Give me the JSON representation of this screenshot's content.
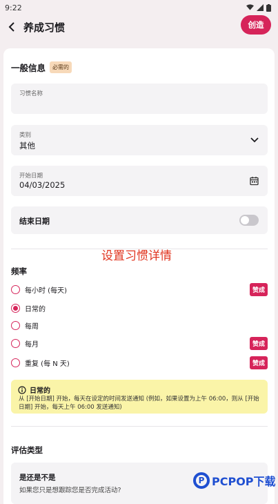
{
  "status": {
    "time": "9:22"
  },
  "appbar": {
    "title": "养成习惯",
    "create_label": "创造"
  },
  "general": {
    "heading": "一般信息",
    "required_badge": "必需的"
  },
  "fields": {
    "habit_name": {
      "label": "习惯名称",
      "value": ""
    },
    "category": {
      "label": "类别",
      "value": "其他"
    },
    "start_date": {
      "label": "开始日期",
      "value": "04/03/2025"
    },
    "end_date": {
      "label": "结束日期",
      "enabled": false
    }
  },
  "overlay_text": "设置习惯详情",
  "frequency": {
    "heading": "频率",
    "options": [
      {
        "label": "每小时 (每天)",
        "selected": false,
        "pro": "赞成"
      },
      {
        "label": "日常的",
        "selected": true,
        "pro": ""
      },
      {
        "label": "每周",
        "selected": false,
        "pro": ""
      },
      {
        "label": "每月",
        "selected": false,
        "pro": "赞成"
      },
      {
        "label": "重复 (每 N 天)",
        "selected": false,
        "pro": "赞成"
      }
    ]
  },
  "info": {
    "title": "日常的",
    "body": "从 [开始日期] 开始，每天在设定的时间发送通知 (例如，如果设置为上午 06:00，则从 [开始日期] 开始，每天上午 06:00 发送通知)"
  },
  "evaluation": {
    "heading": "评估类型",
    "option_title": "是还是不是",
    "option_subtitle": "如果您只是想跟踪您是否完成活动?"
  },
  "watermark": {
    "text": "PCPOP下载",
    "logo_letter": "P"
  },
  "colors": {
    "accent": "#d6245a",
    "info_bg": "#faf4a8",
    "overlay": "#e0331e"
  }
}
